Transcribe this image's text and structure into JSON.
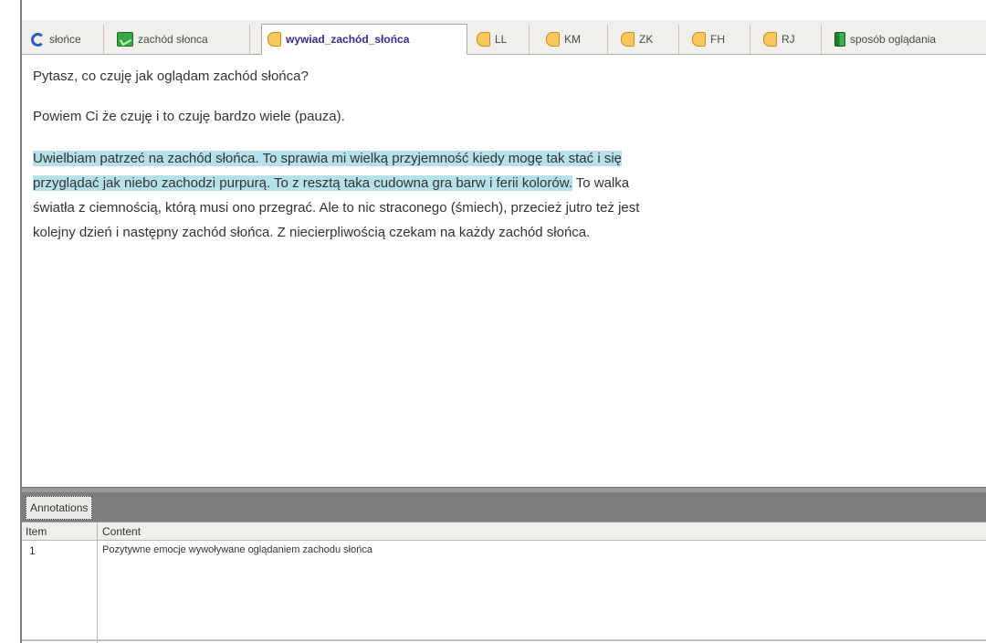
{
  "tabs": [
    {
      "label": "słońce",
      "icon": "cycle-icon"
    },
    {
      "label": "zachód słonca",
      "icon": "image-icon"
    },
    {
      "label": "wywiad_zachód_słońca",
      "icon": "document-icon",
      "active": true
    },
    {
      "label": "LL",
      "icon": "document-icon"
    },
    {
      "label": "KM",
      "icon": "document-icon"
    },
    {
      "label": "ZK",
      "icon": "document-icon"
    },
    {
      "label": "FH",
      "icon": "document-icon"
    },
    {
      "label": "RJ",
      "icon": "document-icon"
    },
    {
      "label": "sposób oglądania",
      "icon": "book-icon"
    }
  ],
  "document": {
    "paragraph1": "Pytasz, co czuję jak oglądam zachód słońca?",
    "paragraph2": "Powiem Ci że czuję i to czuję bardzo wiele (pauza).",
    "line1_highlight": "Uwielbiam patrzeć na zachód słońca. To sprawia mi wielką przyjemność kiedy mogę tak stać i się",
    "line2_highlight": "przyglądać jak niebo zachodzi purpurą. To z resztą taka cudowna gra barw i ferii kolorów.",
    "line2_rest": " To walka",
    "line3": "światła z ciemnością, którą musi ono przegrać. Ale to nic straconego (śmiech), przecież jutro też jest",
    "line4": "kolejny dzień i następny zachód słońca. Z niecierpliwością czekam na każdy zachód słońca.",
    "highlight_color": "#b6e0ea"
  },
  "annotations": {
    "tab_label": "Annotations",
    "columns": [
      "Item",
      "Content"
    ],
    "rows": [
      {
        "item": "1",
        "content": "Pozytywne emocje wywoływane oglądaniem zachodu słońca"
      }
    ]
  }
}
